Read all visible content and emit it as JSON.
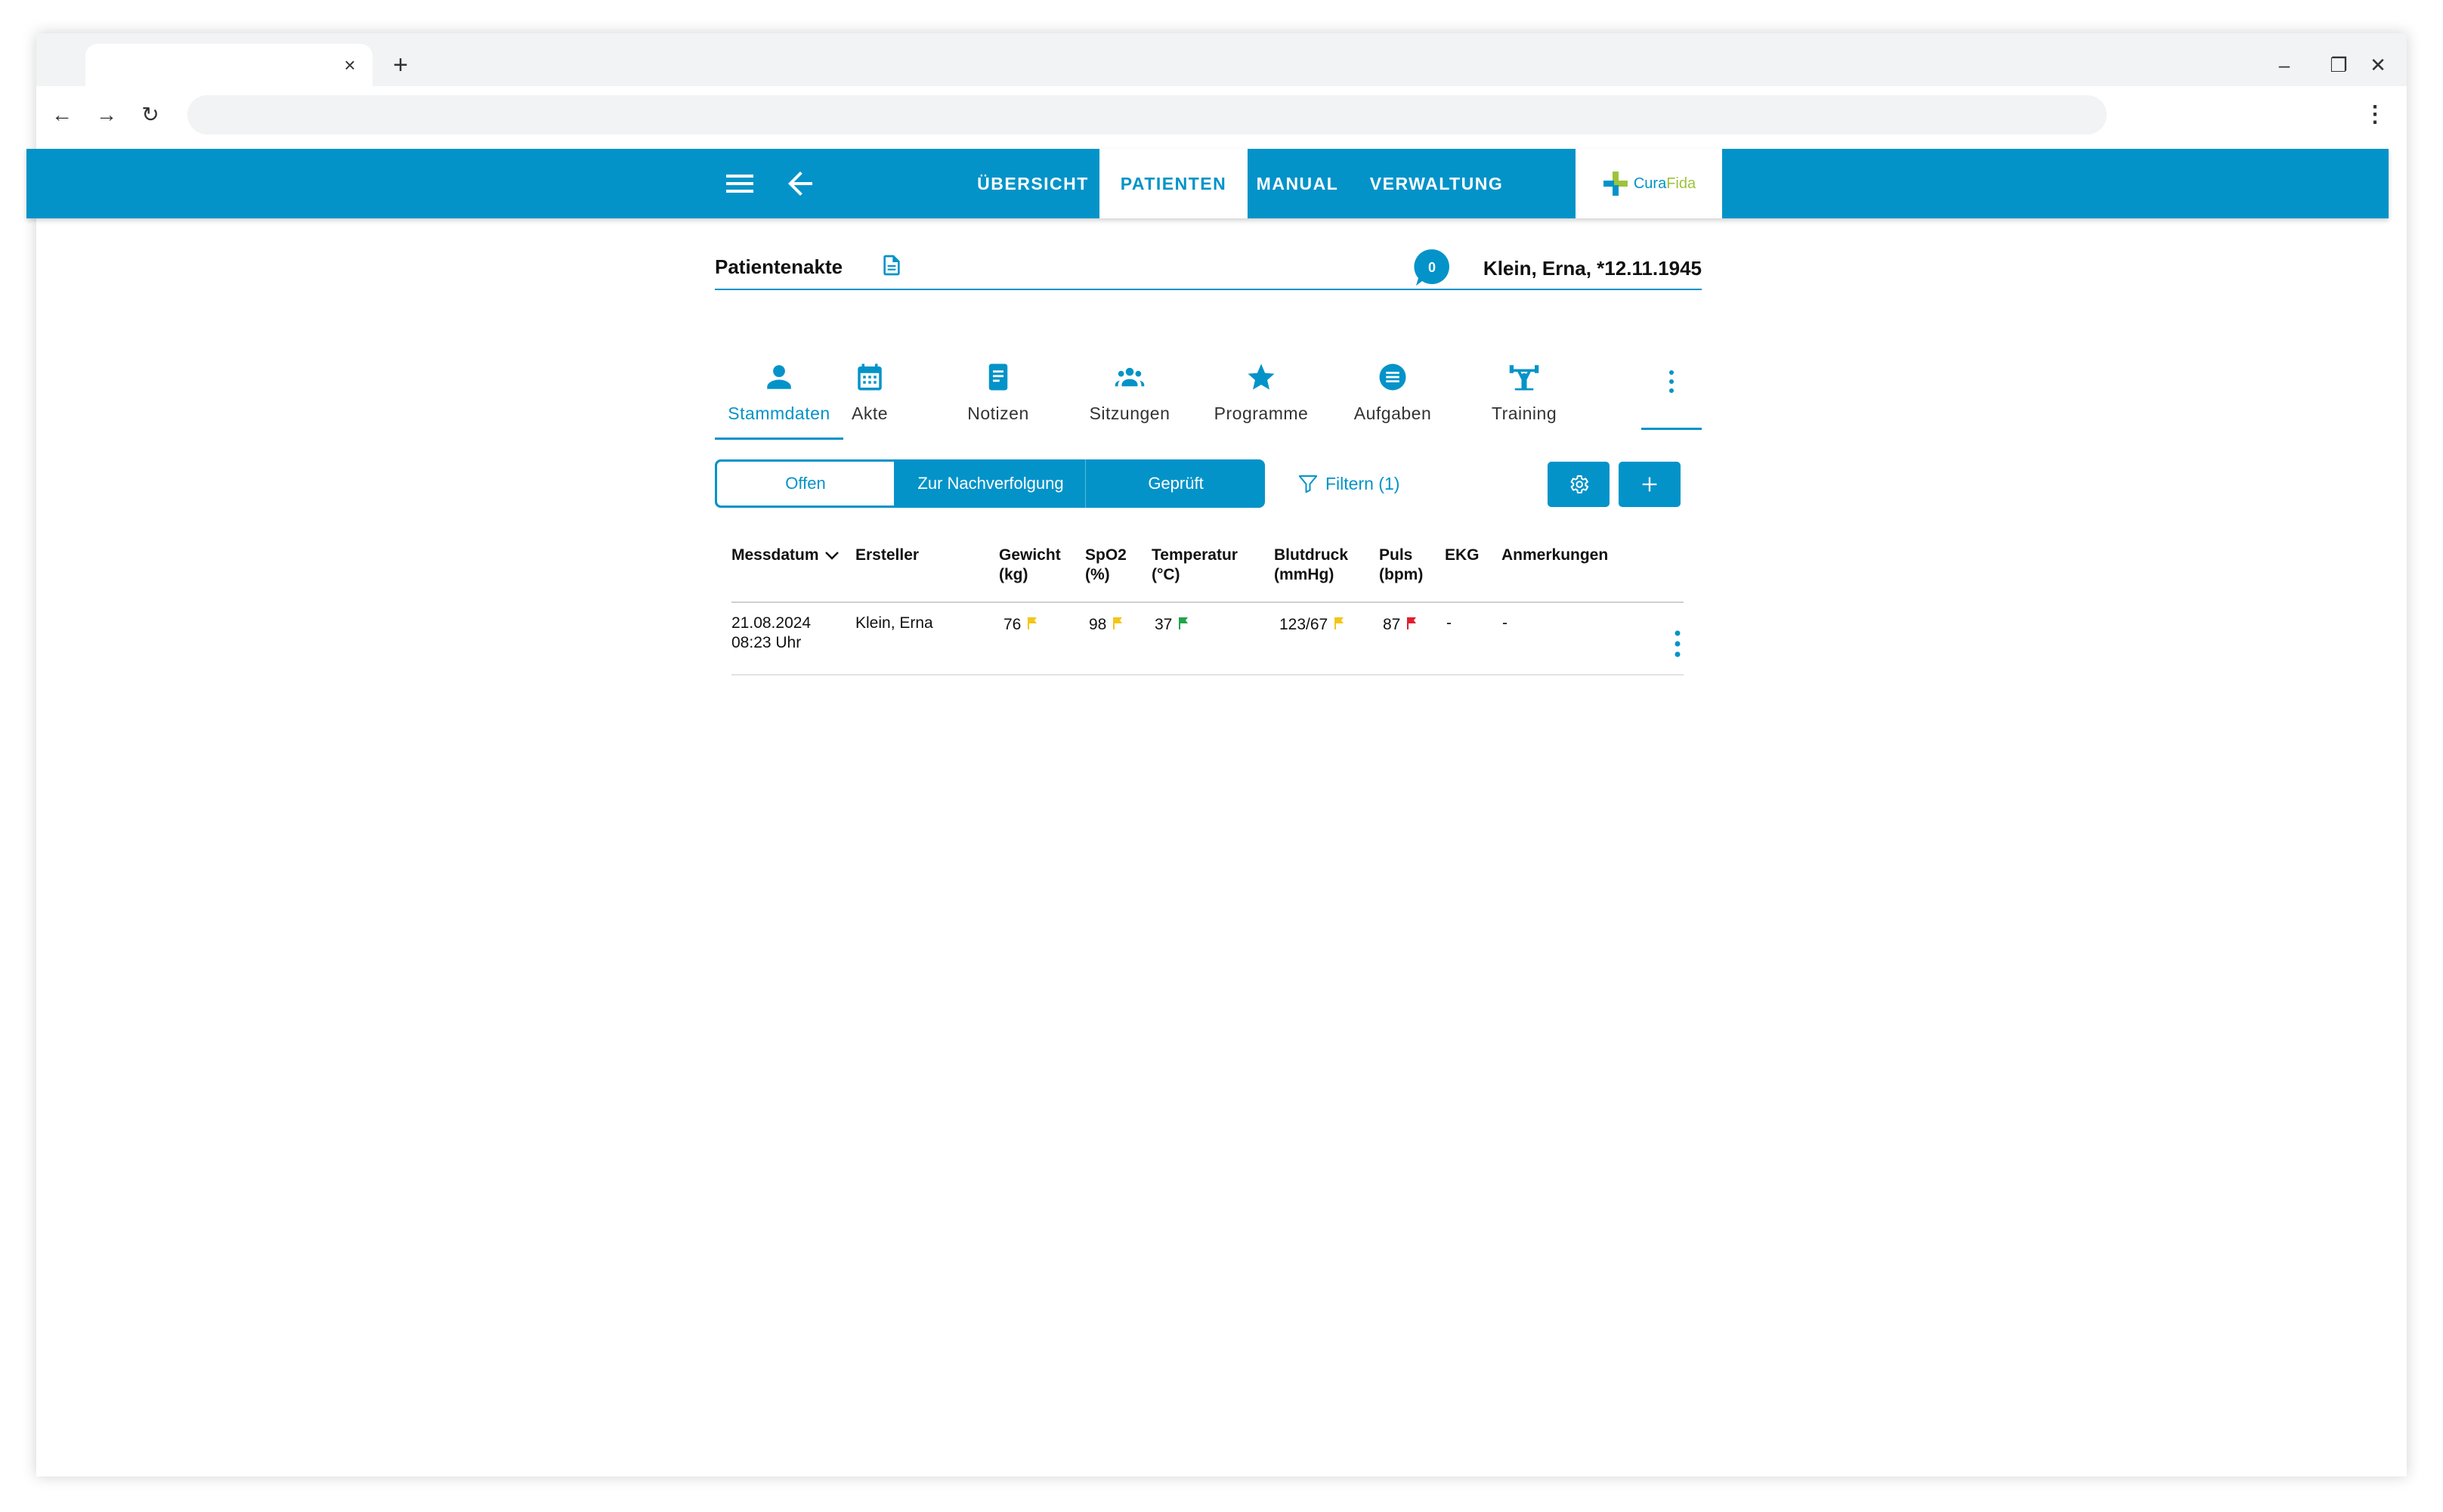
{
  "browser": {
    "tab_close": "×",
    "new_tab": "+",
    "back": "←",
    "forward": "→",
    "reload": "↻",
    "menu": "⋮",
    "minimize": "–",
    "restore": "❐",
    "close": "✕"
  },
  "appbar": {
    "nav": [
      "ÜBERSICHT",
      "PATIENTEN",
      "MANUAL",
      "VERWALTUNG"
    ],
    "active_nav": "PATIENTEN",
    "logo": {
      "cura": "Cura",
      "fida": "Fida"
    }
  },
  "page": {
    "title": "Patientenakte",
    "chat_count": "0",
    "patient": "Klein, Erna, *12.11.1945"
  },
  "sections": [
    {
      "label": "Stammdaten",
      "icon": "person-icon",
      "active": true
    },
    {
      "label": "Akte",
      "icon": "calendar-icon"
    },
    {
      "label": "Notizen",
      "icon": "note-icon"
    },
    {
      "label": "Sitzungen",
      "icon": "group-icon"
    },
    {
      "label": "Programme",
      "icon": "star-icon"
    },
    {
      "label": "Aufgaben",
      "icon": "list-icon"
    },
    {
      "label": "Training",
      "icon": "training-icon"
    }
  ],
  "status_filter": {
    "options": [
      "Offen",
      "Zur Nachverfolgung",
      "Geprüft"
    ],
    "selected": "Offen"
  },
  "filter_label": "Filtern (1)",
  "table": {
    "headers": [
      [
        "Messdatum"
      ],
      [
        "Ersteller"
      ],
      [
        "Gewicht",
        "(kg)"
      ],
      [
        "SpO2",
        "(%)"
      ],
      [
        "Temperatur",
        "(°C)"
      ],
      [
        "Blutdruck",
        "(mmHg)"
      ],
      [
        "Puls",
        "(bpm)"
      ],
      [
        "EKG"
      ],
      [
        "Anmerkungen"
      ]
    ],
    "sort_column": "Messdatum",
    "rows": [
      {
        "date": "21.08.2024",
        "time": "08:23 Uhr",
        "creator": "Klein, Erna",
        "weight": "76",
        "weight_flag": "yellow",
        "spo2": "98",
        "spo2_flag": "yellow",
        "temperature": "37",
        "temperature_flag": "green",
        "blood_pressure": "123/67",
        "blood_pressure_flag": "yellow",
        "pulse": "87",
        "pulse_flag": "red",
        "ekg": "-",
        "notes": "-"
      }
    ]
  },
  "colors": {
    "primary": "#0393c8",
    "flag_yellow": "#f5c518",
    "flag_green": "#1fa54a",
    "flag_red": "#e0202a"
  }
}
